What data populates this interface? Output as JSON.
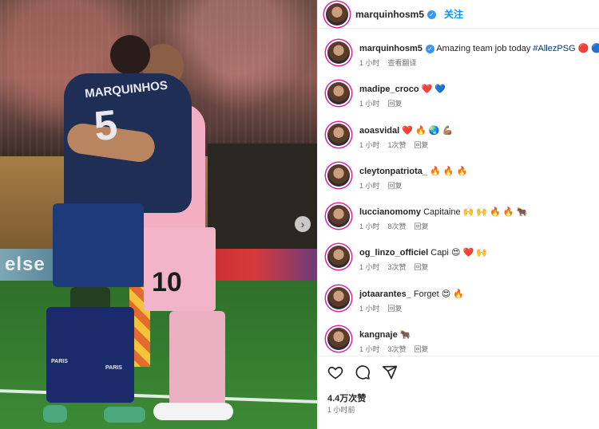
{
  "photo": {
    "jersey_name": "MARQUINHOS",
    "jersey_number": "5",
    "pink_number": "10",
    "banner_text": "else",
    "sock_text": "PARIS"
  },
  "post": {
    "username": "marquinhosm5",
    "follow_label": "关注",
    "likes": "4.4万次赞",
    "posted": "1 小时前"
  },
  "comments": [
    {
      "user": "marquinhosm5",
      "text": "Amazing team job today ",
      "tag": "#AllezPSG",
      "emoji": "🔴 🔵",
      "time": "1 小时",
      "likes": "",
      "action": "查看翻译",
      "verified": true
    },
    {
      "user": "madipe_croco",
      "text": "",
      "tag": "",
      "emoji": "❤️ 💙",
      "time": "1 小时",
      "likes": "",
      "action": "回复",
      "verified": false
    },
    {
      "user": "aoasvidal",
      "text": "",
      "tag": "",
      "emoji": "❤️ 🔥 🌏 💪🏽",
      "time": "1 小时",
      "likes": "1次赞",
      "action": "回复",
      "verified": false
    },
    {
      "user": "cleytonpatriota_",
      "text": "",
      "tag": "",
      "emoji": "🔥 🔥 🔥",
      "time": "1 小时",
      "likes": "",
      "action": "回复",
      "verified": false
    },
    {
      "user": "luccianomomy",
      "text": "Capitaine ",
      "tag": "",
      "emoji": "🙌 🙌 🔥 🔥 🐂",
      "time": "1 小时",
      "likes": "8次赞",
      "action": "回复",
      "verified": false
    },
    {
      "user": "og_linzo_officiel",
      "text": "Capi ",
      "tag": "",
      "emoji": "😍 ❤️ 🙌",
      "time": "1 小时",
      "likes": "3次赞",
      "action": "回复",
      "verified": false
    },
    {
      "user": "jotaarantes_",
      "text": "Forget ",
      "tag": "",
      "emoji": "😍 🔥",
      "time": "1 小时",
      "likes": "",
      "action": "回复",
      "verified": false
    },
    {
      "user": "kangnaje",
      "text": "",
      "tag": "",
      "emoji": "🐂",
      "time": "1 小时",
      "likes": "3次赞",
      "action": "回复",
      "verified": false
    }
  ],
  "icons": {
    "like": "heart-icon",
    "comment": "comment-icon",
    "share": "share-icon",
    "next": "chevron-right-icon"
  },
  "colors": {
    "follow": "#0095f6",
    "verified": "#3897f0",
    "hashtag": "#00376b"
  }
}
